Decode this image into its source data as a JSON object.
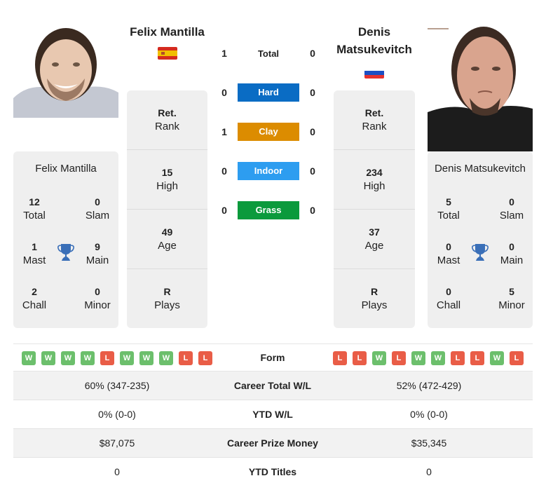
{
  "h2h": {
    "total_label": "Total",
    "p1_total": "1",
    "p2_total": "0",
    "surfaces": [
      {
        "name": "Hard",
        "color": "#0a6cc4",
        "p1": "0",
        "p2": "0"
      },
      {
        "name": "Clay",
        "color": "#dc8c00",
        "p1": "1",
        "p2": "0"
      },
      {
        "name": "Indoor",
        "color": "#2d9df0",
        "p1": "0",
        "p2": "0"
      },
      {
        "name": "Grass",
        "color": "#0b9a3c",
        "p1": "0",
        "p2": "0"
      }
    ]
  },
  "player1": {
    "name": "Felix Mantilla",
    "flag": "spain-flag",
    "rank": {
      "value": "Ret.",
      "label": "Rank"
    },
    "high": {
      "value": "15",
      "label": "High"
    },
    "age": {
      "value": "49",
      "label": "Age"
    },
    "plays": {
      "value": "R",
      "label": "Plays"
    },
    "titles": {
      "name": "Felix Mantilla",
      "total": {
        "value": "12",
        "label": "Total"
      },
      "slam": {
        "value": "0",
        "label": "Slam"
      },
      "mast": {
        "value": "1",
        "label": "Mast"
      },
      "main": {
        "value": "9",
        "label": "Main"
      },
      "chall": {
        "value": "2",
        "label": "Chall"
      },
      "minor": {
        "value": "0",
        "label": "Minor"
      }
    },
    "form": [
      "W",
      "W",
      "W",
      "W",
      "L",
      "W",
      "W",
      "W",
      "L",
      "L"
    ]
  },
  "player2": {
    "name": "Denis Matsukevitch",
    "name_line1": "Denis",
    "name_line2": "Matsukevitch",
    "flag": "russia-flag",
    "rank": {
      "value": "Ret.",
      "label": "Rank"
    },
    "high": {
      "value": "234",
      "label": "High"
    },
    "age": {
      "value": "37",
      "label": "Age"
    },
    "plays": {
      "value": "R",
      "label": "Plays"
    },
    "titles": {
      "name": "Denis Matsukevitch",
      "total": {
        "value": "5",
        "label": "Total"
      },
      "slam": {
        "value": "0",
        "label": "Slam"
      },
      "mast": {
        "value": "0",
        "label": "Mast"
      },
      "main": {
        "value": "0",
        "label": "Main"
      },
      "chall": {
        "value": "0",
        "label": "Chall"
      },
      "minor": {
        "value": "5",
        "label": "Minor"
      }
    },
    "form": [
      "L",
      "L",
      "W",
      "L",
      "W",
      "W",
      "L",
      "L",
      "W",
      "L"
    ]
  },
  "form_label": "Form",
  "stats": [
    {
      "label": "Career Total W/L",
      "p1": "60% (347-235)",
      "p2": "52% (472-429)"
    },
    {
      "label": "YTD W/L",
      "p1": "0% (0-0)",
      "p2": "0% (0-0)"
    },
    {
      "label": "Career Prize Money",
      "p1": "$87,075",
      "p2": "$35,345"
    },
    {
      "label": "YTD Titles",
      "p1": "0",
      "p2": "0"
    }
  ],
  "colors": {
    "win": "#6cbf6c",
    "loss": "#e95d47",
    "trophy": "#3a6fb8",
    "panel": "#efefef"
  }
}
